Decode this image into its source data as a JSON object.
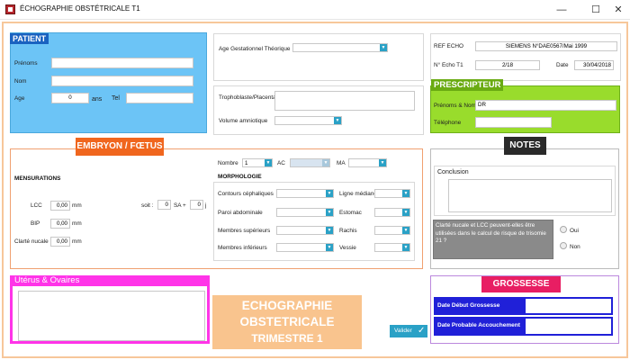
{
  "window": {
    "title": "ÉCHOGRAPHIE OBSTÉTRICALE T1",
    "minimize_glyph": "—",
    "maximize_glyph": "☐",
    "close_glyph": "✕",
    "icon": "app-icon"
  },
  "patient": {
    "title": "PATIENT",
    "prenoms_label": "Prénoms",
    "prenoms_value": "",
    "nom_label": "Nom",
    "nom_value": "",
    "age_label": "Age",
    "age_value": "0",
    "age_unit": "ans",
    "tel_label": "Tel",
    "tel_value": ""
  },
  "grossesse_info": {
    "age_gest_label": "Age Gestationnel Théorique",
    "age_gest_value": "",
    "trophoblaste_label": "Trophoblaste/Placenta",
    "trophoblaste_value": "",
    "volume_label": "Volume amniotique",
    "volume_value": ""
  },
  "ref": {
    "ref_echo_label": "REF ECHO",
    "ref_echo_value": "SIEMENS N°DAE0567/Mai 1999",
    "n_echo_label": "N° Echo T1",
    "n_echo_value": "2/18",
    "date_label": "Date",
    "date_value": "30/04/2018"
  },
  "prescripteur": {
    "title": "PRESCRIPTEUR",
    "prenoms_nom_label": "Prénoms & Nom",
    "prenoms_nom_value": "DR",
    "telephone_label": "Téléphone",
    "telephone_value": ""
  },
  "embryon": {
    "title": "EMBRYON / FŒTUS",
    "nombre_label": "Nombre",
    "nombre_value": "1",
    "ac_label": "AC",
    "ac_value": "",
    "ma_label": "MA",
    "ma_value": "",
    "mensurations_title": "MENSURATIONS",
    "lcc_label": "LCC",
    "lcc_value": "0,00",
    "bip_label": "BIP",
    "bip_value": "0,00",
    "clarte_label": "Clarté nucale",
    "clarte_value": "0,00",
    "unit_mm": "mm",
    "soit_label": "soit :",
    "sa_value": "0",
    "sa_label": "SA +",
    "j_value": "0",
    "j_label": "j",
    "morphologie_title": "MORPHOLOGIE",
    "contours_label": "Contours céphaliques",
    "paroi_label": "Paroi abdominale",
    "membres_sup_label": "Membres supérieurs",
    "membres_inf_label": "Membres inférieurs",
    "ligne_label": "Ligne médiane",
    "estomac_label": "Estomac",
    "rachis_label": "Rachis",
    "vessie_label": "Vessie"
  },
  "notes": {
    "title": "NOTES",
    "conclusion_label": "Conclusion",
    "conclusion_value": "",
    "question": "Clarté nucale et LCC peuvent-elles être utilisées dans le calcul de risque de trisomie 21 ?",
    "oui_label": "Oui",
    "non_label": "Non"
  },
  "uterus": {
    "title": "Utérus & Ovaires",
    "value": ""
  },
  "banner": {
    "line1": "ECHOGRAPHIE",
    "line2": "OBSTETRICALE",
    "line3": "TRIMESTRE 1"
  },
  "valider": {
    "label": "Valider",
    "icon": "check-icon"
  },
  "grossesse": {
    "title": "GROSSESSE",
    "debut_label": "Date Début Grossesse",
    "debut_value": "",
    "accouchement_label": "Date Probable Accouchement",
    "accouchement_value": ""
  },
  "colors": {
    "patient_bg": "#6cc4f6",
    "patient_header": "#1a62c0",
    "prescripteur_bg": "#99dc2c",
    "embryon_header": "#f0661e",
    "notes_header": "#2a2a2a",
    "uterus": "#ff34e8",
    "banner": "#f9c48e",
    "grossesse_header": "#e81e63",
    "grossesse_border": "#2020d8",
    "accent": "#2aa1c6"
  }
}
